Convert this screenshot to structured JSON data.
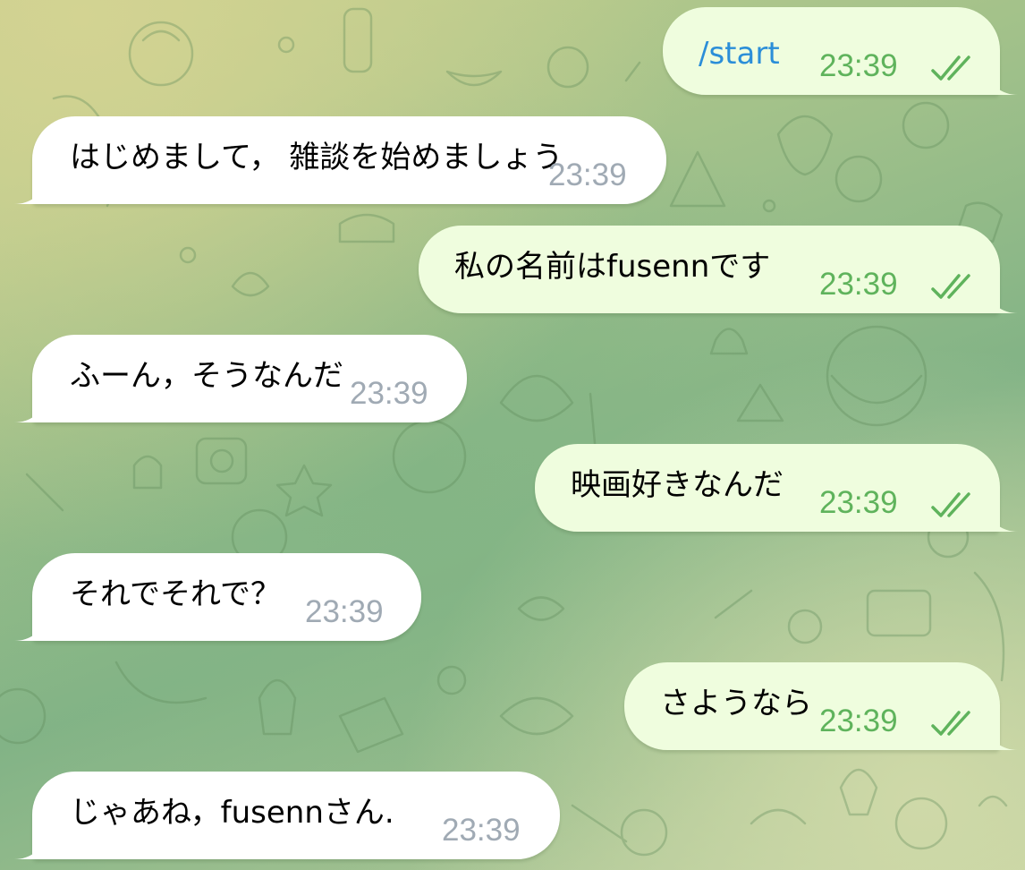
{
  "chat": {
    "messages": [
      {
        "direction": "out",
        "text": "/start",
        "time": "23:39",
        "status_icon": "double-check-icon",
        "is_command": true
      },
      {
        "direction": "in",
        "text": "はじめまして， 雑談を始めましょう",
        "time": "23:39"
      },
      {
        "direction": "out",
        "text": "私の名前はfusennです",
        "time": "23:39",
        "status_icon": "double-check-icon"
      },
      {
        "direction": "in",
        "text": "ふーん，そうなんだ",
        "time": "23:39"
      },
      {
        "direction": "out",
        "text": "映画好きなんだ",
        "time": "23:39",
        "status_icon": "double-check-icon"
      },
      {
        "direction": "in",
        "text": "それでそれで？",
        "time": "23:39"
      },
      {
        "direction": "out",
        "text": "さようなら",
        "time": "23:39",
        "status_icon": "double-check-icon"
      },
      {
        "direction": "in",
        "text": "じゃあね，fusennさん.",
        "time": "23:39"
      }
    ]
  },
  "colors": {
    "incoming_bubble": "#ffffff",
    "outgoing_bubble": "#effdde",
    "command_text": "#2b8ed8",
    "incoming_time": "#a0aab4",
    "outgoing_time_and_checks": "#5fb35c"
  }
}
